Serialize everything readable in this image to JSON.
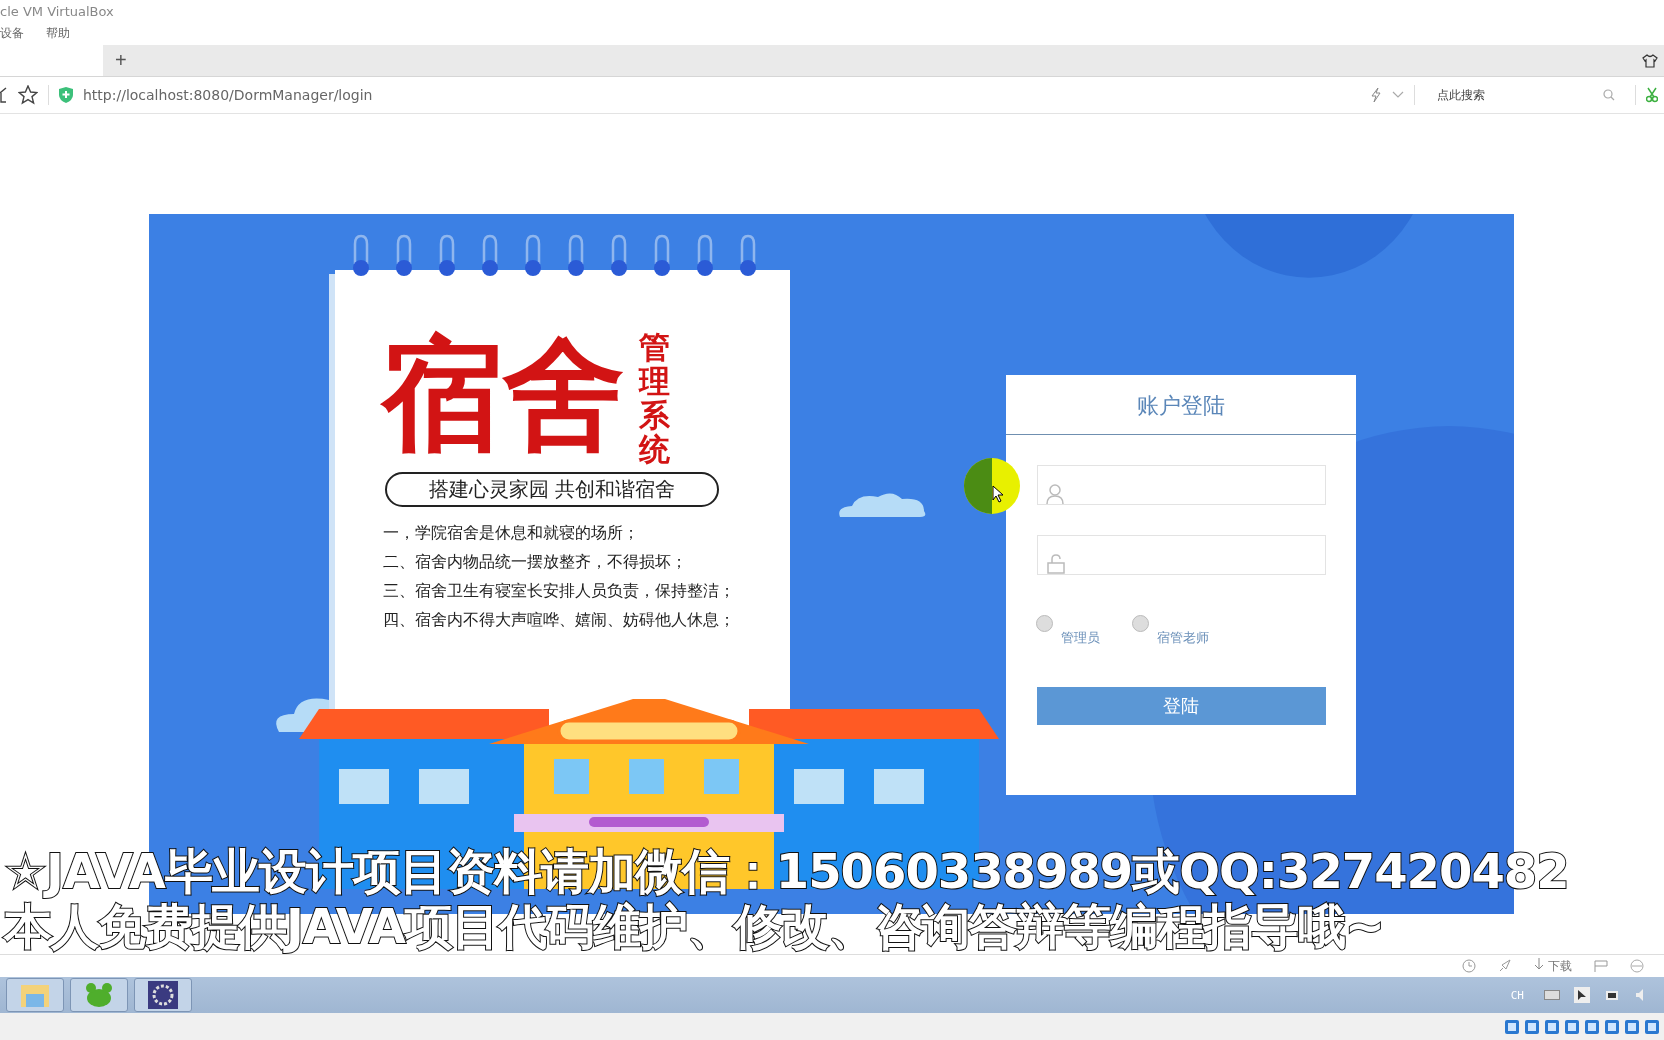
{
  "vm_window": {
    "title": "cle VM VirtualBox",
    "menu": [
      "设备",
      "帮助"
    ]
  },
  "browser": {
    "new_tab": "+",
    "address": "http://localhost:8080/DormManager/login",
    "search": {
      "placeholder": "点此搜索"
    },
    "status_bar": {
      "download": "下载"
    }
  },
  "poster": {
    "title": "宿舍",
    "subtitle": "管理系统",
    "slogan": "搭建心灵家园 共创和谐宿舍",
    "rules": [
      "一，学院宿舍是休息和就寝的场所；",
      "二、宿舍内物品统一摆放整齐，不得损坏；",
      "三、宿舍卫生有寝室长安排人员负责，保持整洁；",
      "四、宿舍内不得大声喧哗、嬉闹、妨碍他人休息；"
    ]
  },
  "login": {
    "title": "账户登陆",
    "roles": [
      {
        "label": "管理员",
        "selected": false
      },
      {
        "label": "宿管老师",
        "selected": false
      }
    ],
    "button": "登陆"
  },
  "caption": [
    "☆JAVA毕业设计项目资料请加微信：15060338989或QQ:327420482",
    "本人免费提供JAVA项目代码维护、修改、咨询答辩等编程指导哦~"
  ],
  "vm_status": {
    "language": "CH"
  }
}
